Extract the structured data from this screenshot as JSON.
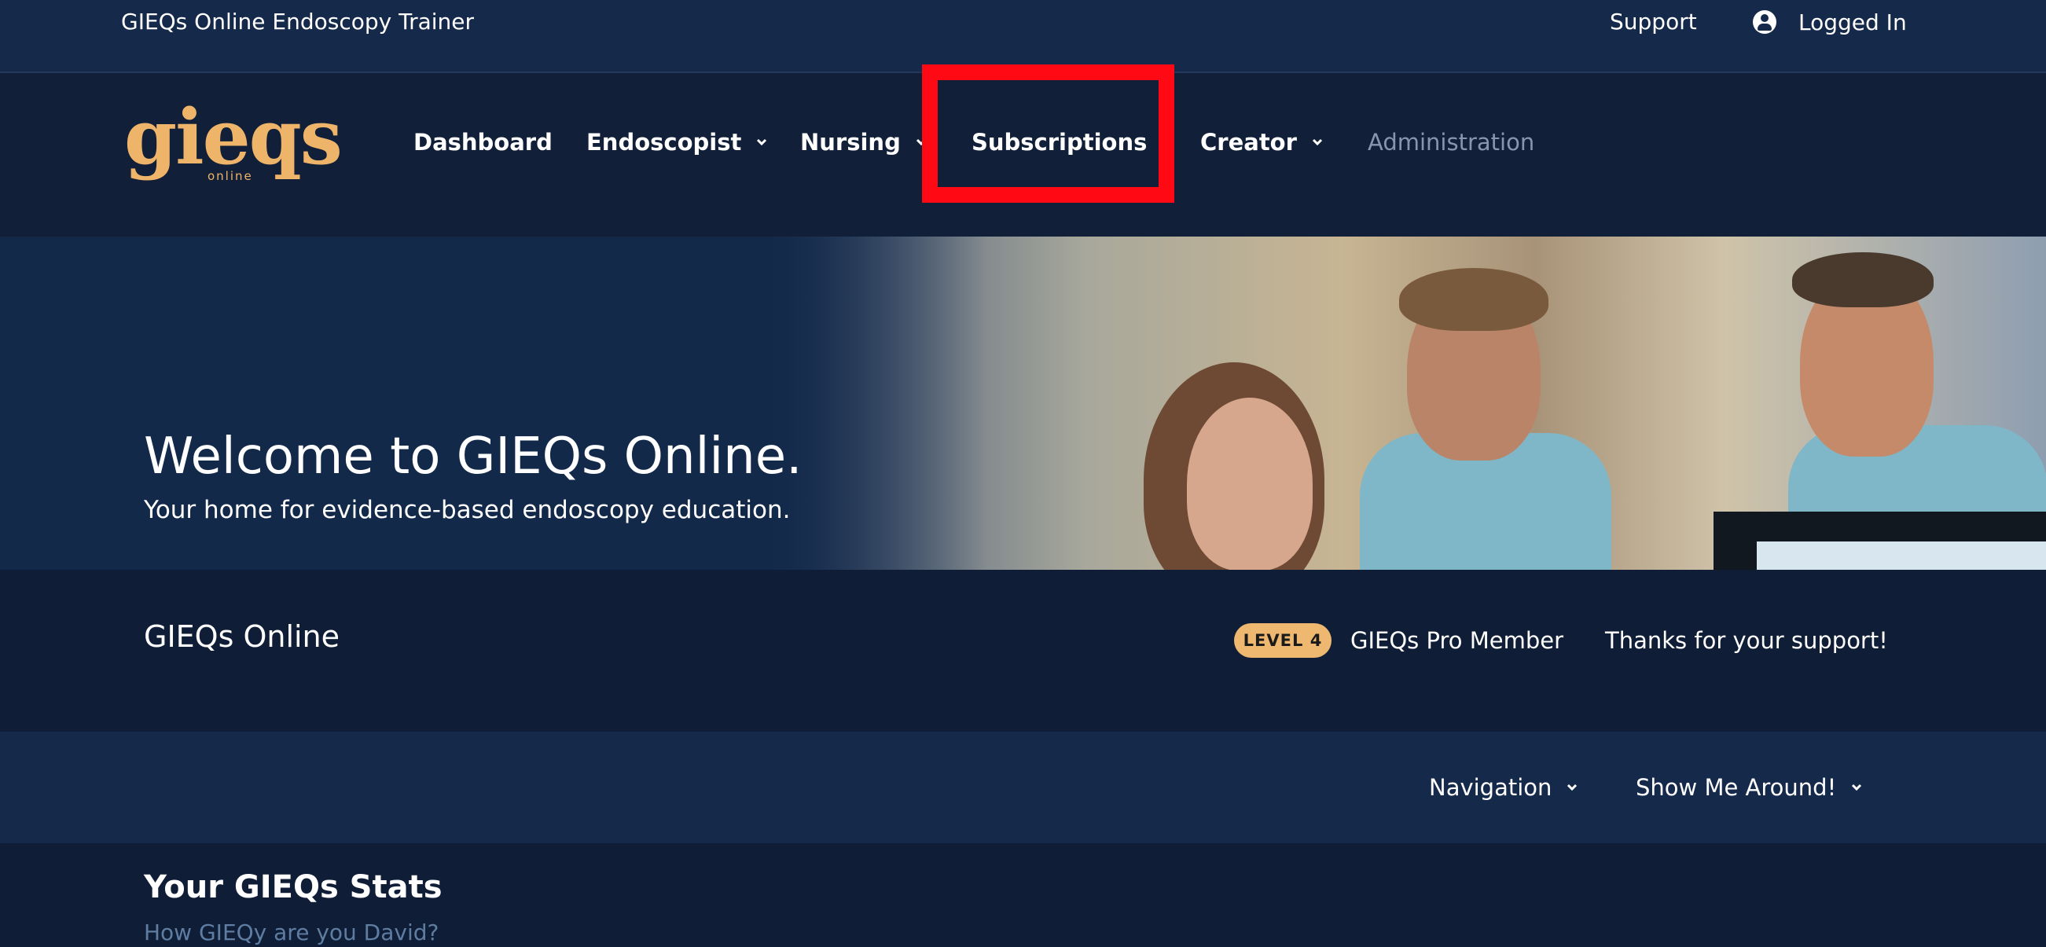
{
  "topbar": {
    "title": "GIEQs Online Endoscopy Trainer",
    "support": "Support",
    "user_status": "Logged In"
  },
  "logo": {
    "main": "gieqs",
    "sub": "online"
  },
  "nav": {
    "items": [
      {
        "label": "Dashboard"
      },
      {
        "label": "Endoscopist"
      },
      {
        "label": "Nursing"
      },
      {
        "label": "Subscriptions"
      },
      {
        "label": "Creator"
      },
      {
        "label": "Administration"
      }
    ]
  },
  "hero": {
    "title": "Welcome to GIEQs Online.",
    "subtitle": "Your home for evidence-based endoscopy education."
  },
  "status": {
    "title": "GIEQs Online",
    "level": "LEVEL 4",
    "membership": "GIEQs Pro Member",
    "thanks": "Thanks for your support!"
  },
  "subnav": {
    "navigation": "Navigation",
    "tour": "Show Me Around!"
  },
  "stats": {
    "title": "Your GIEQs Stats",
    "subtitle": "How GIEQy are you David?"
  },
  "colors": {
    "accent": "#eeb46a",
    "highlight": "#ff0a14",
    "background": "#0f1e36"
  },
  "icons": {
    "user": "user-circle-icon",
    "chevron": "chevron-down-icon"
  }
}
